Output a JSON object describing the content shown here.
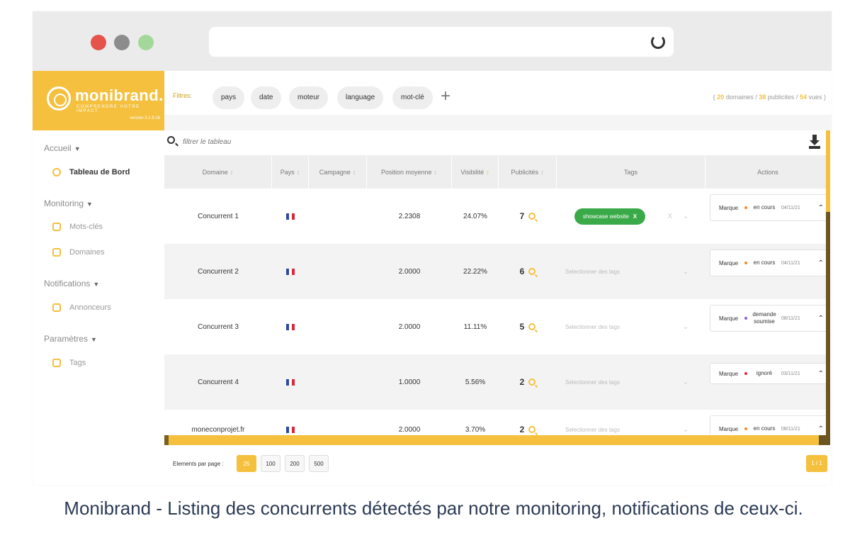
{
  "app": {
    "logo": "monibrand.",
    "logo_tagline": "COMPRENDRE VOTRE IMPACT",
    "logo_version": "version 3.1.9.16"
  },
  "sidebar": {
    "sections": [
      {
        "label": "Accueil",
        "items": [
          {
            "label": "Tableau de Bord",
            "active": true,
            "icon": "dashboard-icon"
          }
        ]
      },
      {
        "label": "Monitoring",
        "items": [
          {
            "label": "Mots-clés",
            "icon": "keywords-icon"
          },
          {
            "label": "Domaines",
            "icon": "domains-icon"
          }
        ]
      },
      {
        "label": "Notifications",
        "items": [
          {
            "label": "Annonceurs",
            "icon": "advertisers-icon"
          }
        ]
      },
      {
        "label": "Paramètres",
        "items": [
          {
            "label": "Tags",
            "icon": "tags-icon"
          }
        ]
      }
    ]
  },
  "filters": {
    "label": "Filtres:",
    "chips": [
      "pays",
      "date",
      "moteur",
      "language",
      "mot-clé"
    ],
    "add": "+",
    "summary": {
      "open": "(",
      "domaines_count": "20",
      "domaines_label": "domaines /",
      "publicites_count": "38",
      "publicites_label": "publicites /",
      "vues_count": "54",
      "vues_label": "vues )"
    }
  },
  "table": {
    "search_placeholder": "filtrer le tableau",
    "columns": [
      "Domaine",
      "Pays",
      "Campagne",
      "Position moyenne",
      "Visibilité",
      "Publicités",
      "Tags",
      "Actions"
    ],
    "sort_glyph": "↕",
    "rows": [
      {
        "domaine": "Concurrent 1",
        "position": "2.2308",
        "visibilite": "24.07%",
        "publicites": "7",
        "tag": "showcase website",
        "tag_close": "X",
        "clear": "X",
        "chev": "⌄",
        "action_label": "Marque",
        "action_dot": "#f08c2c",
        "status": "en cours",
        "date": "04/11/21",
        "action_chev": "⌃"
      },
      {
        "domaine": "Concurrent 2",
        "position": "2.0000",
        "visibilite": "22.22%",
        "publicites": "6",
        "tag_placeholder": "Selectionner des tags",
        "chev": "⌄",
        "action_label": "Marque",
        "action_dot": "#f08c2c",
        "status": "en cours",
        "date": "04/11/21",
        "action_chev": "⌃"
      },
      {
        "domaine": "Concurrent 3",
        "position": "2.0000",
        "visibilite": "11.11%",
        "publicites": "5",
        "tag_placeholder": "Selectionner des tags",
        "chev": "⌄",
        "action_label": "Marque",
        "action_dot": "#8a5cd8",
        "status": "demande soumise",
        "date": "08/11/21",
        "action_chev": "⌃"
      },
      {
        "domaine": "Concurrent 4",
        "position": "1.0000",
        "visibilite": "5.56%",
        "publicites": "2",
        "tag_placeholder": "Selectionner des tags",
        "chev": "⌄",
        "action_label": "Marque",
        "action_dot": "#d8283a",
        "status": "ignoré",
        "date": "03/11/21",
        "action_chev": "⌃"
      },
      {
        "domaine": "moneconprojet.fr",
        "position": "2.0000",
        "visibilite": "3.70%",
        "publicites": "2",
        "tag_placeholder": "Selectionner des tags",
        "chev": "⌄",
        "action_label": "Marque",
        "action_dot": "#f08c2c",
        "status": "en cours",
        "date": "08/11/21",
        "action_chev": "⌃"
      }
    ]
  },
  "pager": {
    "label": "Elements par page :",
    "sizes": [
      "25",
      "100",
      "200",
      "500"
    ],
    "active_size": "25",
    "page_indicator": "1 / 1"
  },
  "caption": "Monibrand - Listing des concurrents détectés par notre monitoring, notifications de ceux-ci."
}
